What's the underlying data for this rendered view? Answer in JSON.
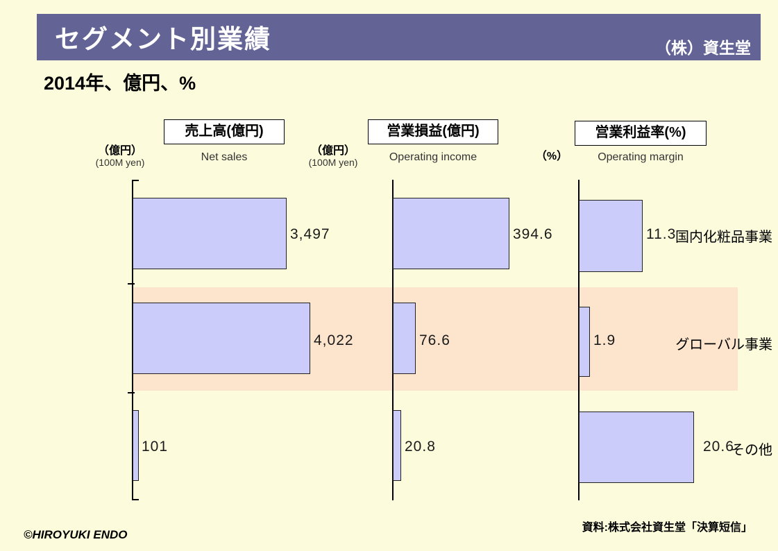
{
  "header": {
    "title": "セグメント別業績",
    "company": "（株）資生堂",
    "bar_color": "#636395"
  },
  "subtitle": "2014年、億円、%",
  "page": {
    "background_color": "#fcfcdc",
    "bar_fill_color": "#ccccfa",
    "highlight_band_color": "#fce4cd"
  },
  "footer": {
    "copyright": "©HIROYUKI  ENDO",
    "source": "資料:株式会社資生堂「決算短信」"
  },
  "rows": [
    {
      "label": "国内化粧品事業",
      "highlighted": false
    },
    {
      "label": "グローバル事業",
      "highlighted": true
    },
    {
      "label": "その他",
      "highlighted": false
    }
  ],
  "panels": [
    {
      "title": "売上高(億円)",
      "subtitle": "Net sales",
      "unit_jp": "（億円）",
      "unit_en": "(100M yen)"
    },
    {
      "title": "営業損益(億円)",
      "subtitle": "Operating income",
      "unit_jp": "（億円）",
      "unit_en": "(100M yen)"
    },
    {
      "title": "営業利益率(%)",
      "subtitle": "Operating margin",
      "unit_jp": "（%）",
      "unit_en": ""
    }
  ],
  "values": {
    "net_sales": [
      "3,497",
      "4,022",
      "101"
    ],
    "operating_income": [
      "394.6",
      "76.6",
      "20.8"
    ],
    "operating_margin": [
      "11.3",
      "1.9",
      "20.6"
    ]
  },
  "chart_data": {
    "type": "bar",
    "title": "セグメント別業績",
    "subtitle": "2014年、億円、%",
    "orientation": "horizontal",
    "grid": false,
    "legend": "none",
    "categories": [
      "国内化粧品事業",
      "グローバル事業",
      "その他"
    ],
    "panels": [
      {
        "title": "売上高(億円)",
        "subtitle": "Net sales",
        "ylabel": "（億円）",
        "ylabel_en": "(100M yen)",
        "values": [
          3497,
          4022,
          101
        ],
        "value_labels": [
          "3,497",
          "4,022",
          "101"
        ],
        "xlim": [
          0,
          5000
        ]
      },
      {
        "title": "営業損益(億円)",
        "subtitle": "Operating income",
        "ylabel": "（億円）",
        "ylabel_en": "(100M yen)",
        "values": [
          394.6,
          76.6,
          20.8
        ],
        "value_labels": [
          "394.6",
          "76.6",
          "20.8"
        ],
        "xlim": [
          0,
          500
        ]
      },
      {
        "title": "営業利益率(%)",
        "subtitle": "Operating margin",
        "ylabel": "（%）",
        "ylabel_en": "",
        "values": [
          11.3,
          1.9,
          20.6
        ],
        "value_labels": [
          "11.3",
          "1.9",
          "20.6"
        ],
        "xlim": [
          0,
          26
        ]
      }
    ],
    "annotations": {
      "highlighted_category": "グローバル事業",
      "source": "資料:株式会社資生堂「決算短信」",
      "credit": "©HIROYUKI  ENDO"
    }
  }
}
